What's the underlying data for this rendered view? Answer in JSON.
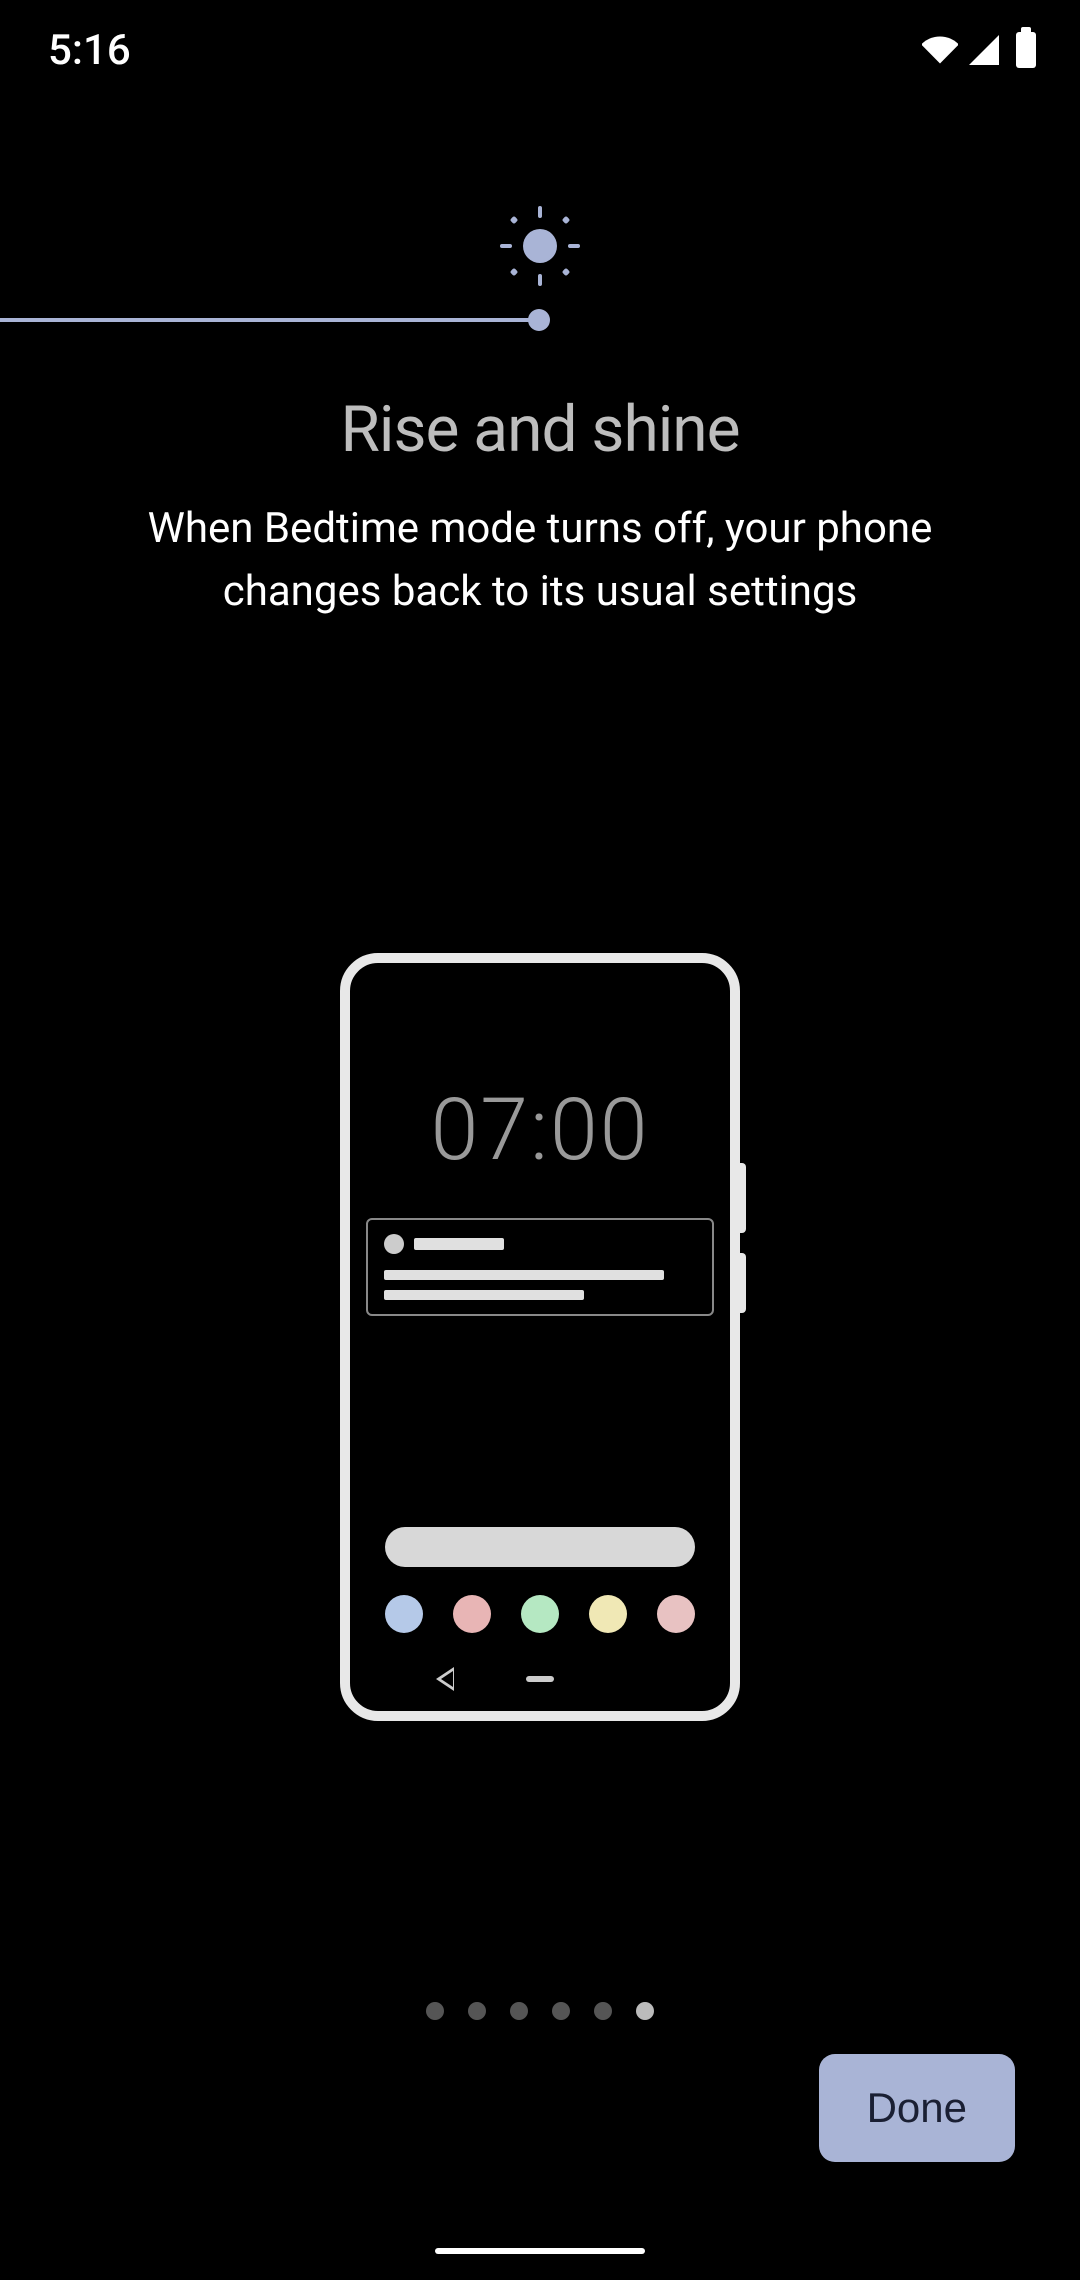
{
  "status_bar": {
    "time": "5:16"
  },
  "onboarding": {
    "title": "Rise and shine",
    "description": "When Bedtime mode turns off, your phone changes back to its usual settings"
  },
  "illustration": {
    "phone_time": "07:00",
    "app_colors": [
      "#b5c9e8",
      "#e8b5b5",
      "#b5e8c2",
      "#f0e8b5",
      "#e8c2c2"
    ]
  },
  "pagination": {
    "total": 6,
    "current": 6
  },
  "buttons": {
    "done": "Done"
  },
  "colors": {
    "accent": "#a9b4d6"
  }
}
